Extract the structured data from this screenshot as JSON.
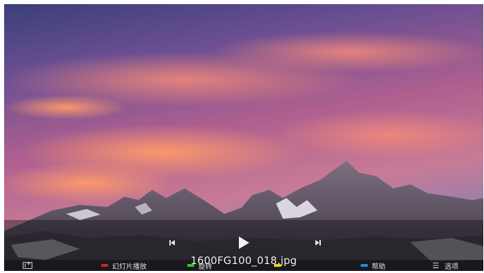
{
  "viewer": {
    "file_name": "1600FG100_018.jpg"
  },
  "controls": {
    "prev_icon": "skip-previous-icon",
    "play_icon": "play-icon",
    "next_icon": "skip-next-icon"
  },
  "bottom_bar": {
    "exit_icon": "exit-app-icon",
    "slideshow": {
      "color": "#e01e1e",
      "label": "幻灯片播放"
    },
    "rotate": {
      "color": "#22cc22",
      "label": "旋转"
    },
    "yellow_key": {
      "color": "#f2d41a"
    },
    "help": {
      "color": "#1e90e0",
      "label": "帮助"
    },
    "options": {
      "icon": "menu-icon",
      "label": "选项"
    }
  }
}
